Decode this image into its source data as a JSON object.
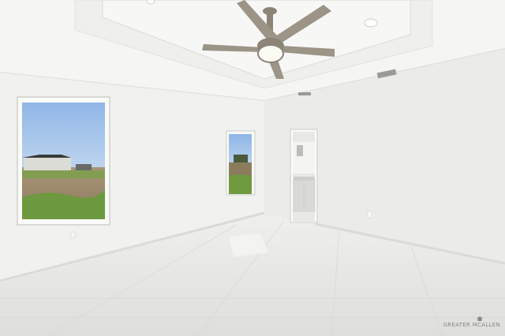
{
  "photo": {
    "subject": "empty-bedroom",
    "watermark": "GREATER MCALLEN"
  },
  "colors": {
    "wall_left": "#f2f2f0",
    "wall_right": "#ececea",
    "ceiling": "#f6f6f4",
    "floor": "#e6e6e4",
    "sky": "#bcd4ec",
    "grass": "#6f9a3e",
    "dirt": "#a48e72",
    "fan_metal": "#8c8477"
  }
}
